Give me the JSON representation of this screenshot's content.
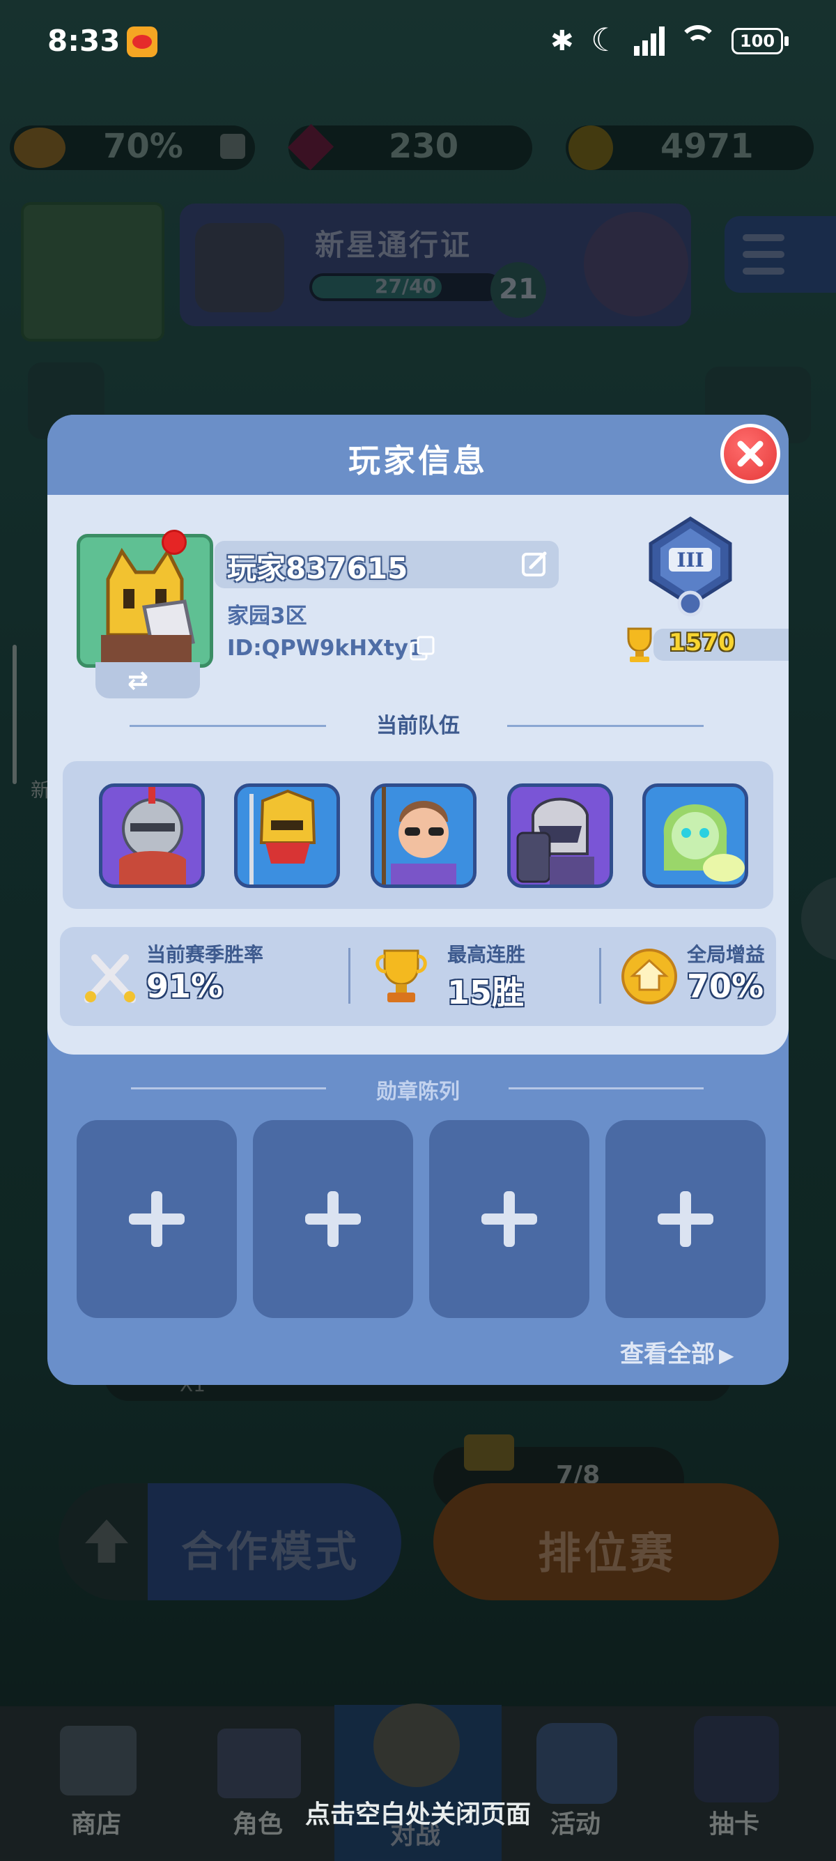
{
  "status_bar": {
    "time": "8:33",
    "battery": "100",
    "icons": [
      "weibo-app-icon",
      "bluetooth-icon",
      "moon-icon",
      "signal-icon",
      "wifi-icon",
      "battery-icon"
    ]
  },
  "background": {
    "resources": [
      {
        "icon": "home-boost-icon",
        "value": "70%"
      },
      {
        "icon": "gem-icon",
        "value": "230"
      },
      {
        "icon": "coin-icon",
        "value": "4971"
      }
    ],
    "pass": {
      "title": "新星通行证",
      "progress": "27/40",
      "level": "21"
    },
    "counter": "7/8",
    "multiplier": "X1",
    "coop_mode": "合作模式",
    "ranked": "排位赛",
    "nav": [
      {
        "label": "商店",
        "icon": "shop-icon"
      },
      {
        "label": "角色",
        "icon": "character-icon"
      },
      {
        "label": "对战",
        "icon": "battle-icon"
      },
      {
        "label": "活动",
        "icon": "event-icon"
      },
      {
        "label": "抽卡",
        "icon": "gacha-icon"
      }
    ],
    "side_labels": [
      "新"
    ]
  },
  "modal": {
    "title": "玩家信息",
    "player": {
      "name": "玩家837615",
      "server": "家园3区",
      "id": "ID:QPW9kHXty1",
      "rank_trophies": "1570"
    },
    "team_heading": "当前队伍",
    "team": [
      {
        "icon": "knight-hero-icon",
        "frame": "#7a55d6"
      },
      {
        "icon": "golden-warrior-hero-icon",
        "frame": "#3c8fe0"
      },
      {
        "icon": "spear-hero-icon",
        "frame": "#3c8fe0"
      },
      {
        "icon": "dark-knight-hero-icon",
        "frame": "#7a55d6"
      },
      {
        "icon": "forest-spirit-hero-icon",
        "frame": "#3c8fe0"
      }
    ],
    "stats": [
      {
        "label": "当前赛季胜率",
        "value": "91%",
        "icon": "crossed-swords-icon"
      },
      {
        "label": "最高连胜",
        "value": "15胜",
        "icon": "trophy-icon"
      },
      {
        "label": "全局增益",
        "value": "70%",
        "icon": "home-boost-icon"
      }
    ],
    "badge_heading": "勋章陈列",
    "badge_slots": 4,
    "view_all": "查看全部"
  },
  "close_hint": "点击空白处关闭页面",
  "colors": {
    "modal_blue": "#6a8fca",
    "card_bg": "#dbe5f4",
    "close_red": "#e53a3a",
    "gold": "#f4c22a"
  }
}
